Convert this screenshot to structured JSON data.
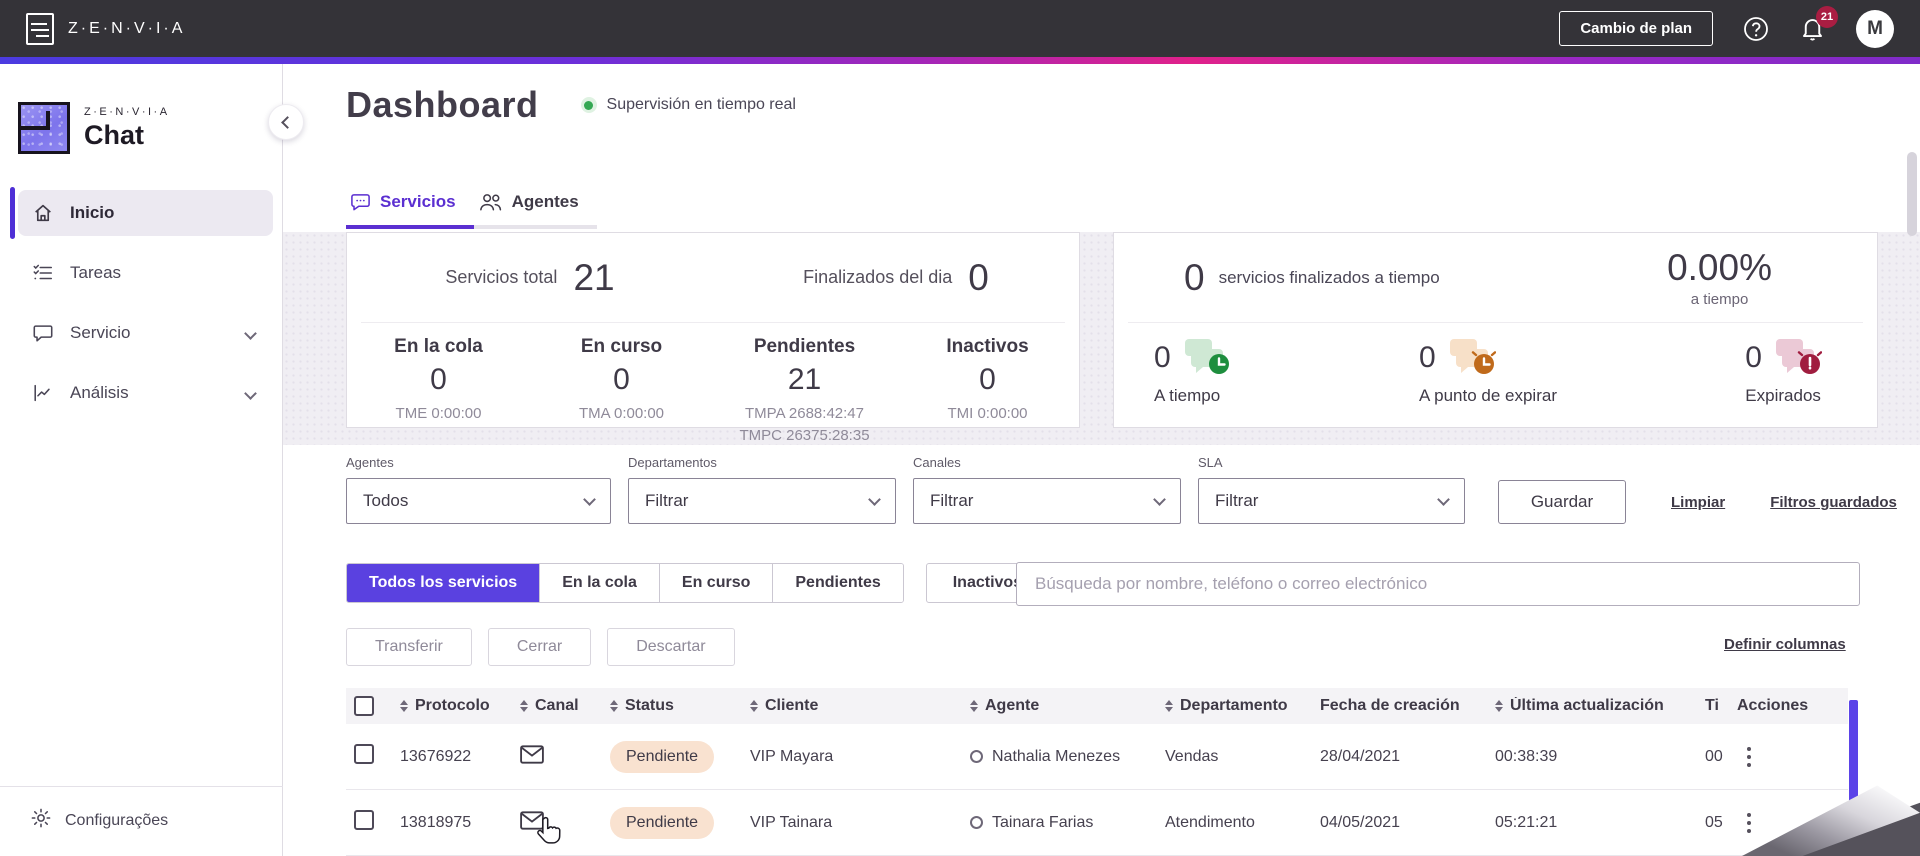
{
  "topbar": {
    "brand": "Z·E·N·V·I·A",
    "change_plan_label": "Cambio de plan",
    "notification_count": "21",
    "avatar_initial": "M"
  },
  "sidebar": {
    "brand_small": "Z·E·N·V·I·A",
    "product": "Chat",
    "items": [
      {
        "label": "Inicio"
      },
      {
        "label": "Tareas"
      },
      {
        "label": "Servicio"
      },
      {
        "label": "Análisis"
      }
    ],
    "footer": {
      "label": "Configurações"
    }
  },
  "header": {
    "title": "Dashboard",
    "live_status": "Supervisión en tiempo real"
  },
  "tabs": [
    {
      "label": "Servicios"
    },
    {
      "label": "Agentes"
    }
  ],
  "summary_card": {
    "totals": [
      {
        "label": "Servicios total",
        "value": "21"
      },
      {
        "label": "Finalizados del dia",
        "value": "0"
      }
    ],
    "breakdown": [
      {
        "label": "En la cola",
        "value": "0",
        "sub": [
          "TME 0:00:00"
        ]
      },
      {
        "label": "En curso",
        "value": "0",
        "sub": [
          "TMA 0:00:00"
        ]
      },
      {
        "label": "Pendientes",
        "value": "21",
        "sub": [
          "TMPA 2688:42:47",
          "TMPC 26375:28:35"
        ]
      },
      {
        "label": "Inactivos",
        "value": "0",
        "sub": [
          "TMI 0:00:00"
        ]
      }
    ]
  },
  "sla_card": {
    "finished_value": "0",
    "finished_label": "servicios finalizados a tiempo",
    "percent_value": "0.00%",
    "percent_label": "a tiempo",
    "metrics": [
      {
        "value": "0",
        "label": "A tiempo",
        "color": "#1E8E3E",
        "tint": "#CFE8D4"
      },
      {
        "value": "0",
        "label": "A punto de expirar",
        "color": "#C06A1B",
        "tint": "#F7E0C8"
      },
      {
        "value": "0",
        "label": "Expirados",
        "color": "#A01D3F",
        "tint": "#EBC9D6"
      }
    ]
  },
  "filters": {
    "fields": [
      {
        "label": "Agentes",
        "value": "Todos"
      },
      {
        "label": "Departamentos",
        "value": "Filtrar"
      },
      {
        "label": "Canales",
        "value": "Filtrar"
      },
      {
        "label": "SLA",
        "value": "Filtrar"
      }
    ],
    "save_label": "Guardar",
    "clear_label": "Limpiar",
    "saved_filters_label": "Filtros guardados"
  },
  "service_filter": {
    "segments": [
      "Todos los servicios",
      "En la cola",
      "En curso",
      "Pendientes"
    ],
    "standalone": "Inactivos"
  },
  "search": {
    "placeholder": "Búsqueda por nombre, teléfono o correo electrónico"
  },
  "bulk_actions": {
    "transfer": "Transferir",
    "close": "Cerrar",
    "discard": "Descartar",
    "define_columns": "Definir columnas"
  },
  "table": {
    "columns": [
      {
        "label": "Protocolo",
        "sortable": true
      },
      {
        "label": "Canal",
        "sortable": true
      },
      {
        "label": "Status",
        "sortable": true
      },
      {
        "label": "Cliente",
        "sortable": true
      },
      {
        "label": "Agente",
        "sortable": true
      },
      {
        "label": "Departamento",
        "sortable": true
      },
      {
        "label": "Fecha de creación",
        "sortable": false
      },
      {
        "label": "Última actualización",
        "sortable": true
      },
      {
        "label": "Ti",
        "sortable": false
      },
      {
        "label": "Acciones",
        "sortable": false
      }
    ],
    "rows": [
      {
        "protocol": "13676922",
        "channel": "email",
        "status": "Pendiente",
        "client": "VIP Mayara",
        "agent": "Nathalia Menezes",
        "department": "Vendas",
        "created": "28/04/2021",
        "updated": "00:38:39",
        "time": "00"
      },
      {
        "protocol": "13818975",
        "channel": "email",
        "status": "Pendiente",
        "client": "VIP Tainara",
        "agent": "Tainara Farias",
        "department": "Atendimento",
        "created": "04/05/2021",
        "updated": "05:21:21",
        "time": "05"
      }
    ]
  },
  "colors": {
    "accent_purple": "#5A41E0",
    "tab_purple": "#5B2FD1",
    "topbar_bg": "#343338",
    "pending_badge_bg": "#F9E2D0",
    "live_green": "#34A853",
    "notification_red": "#A91D42",
    "table_scrollbar": "#5B43E8"
  }
}
